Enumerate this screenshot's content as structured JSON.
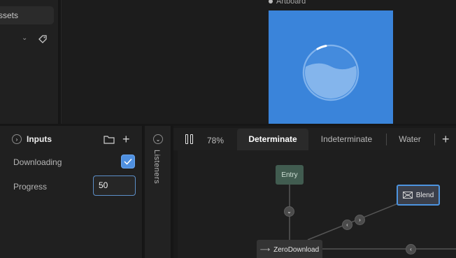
{
  "assets": {
    "tab_label": "ssets"
  },
  "artboard": {
    "label": "Artboard",
    "background": "#3a84da"
  },
  "inputs": {
    "title": "Inputs",
    "fields": [
      {
        "label": "Downloading",
        "type": "checkbox",
        "checked": true
      },
      {
        "label": "Progress",
        "type": "number",
        "value": "50"
      }
    ]
  },
  "listeners": {
    "label": "Listeners"
  },
  "toolbar": {
    "zoom": "78%"
  },
  "tabs": [
    {
      "label": "Determinate",
      "active": true
    },
    {
      "label": "Indeterminate",
      "active": false
    },
    {
      "label": "Water",
      "active": false
    }
  ],
  "graph": {
    "nodes": {
      "entry": "Entry",
      "blend": "Blend",
      "zero_download": "ZeroDownload"
    }
  },
  "colors": {
    "accent": "#4f90e0",
    "entry_node": "#415c50",
    "selection": "#4d94e0"
  },
  "icons": [
    "tag-icon",
    "chevron-down-icon",
    "folder-icon",
    "plus-icon",
    "pause-icon",
    "check-icon",
    "blend-icon",
    "arrow-right-icon"
  ]
}
